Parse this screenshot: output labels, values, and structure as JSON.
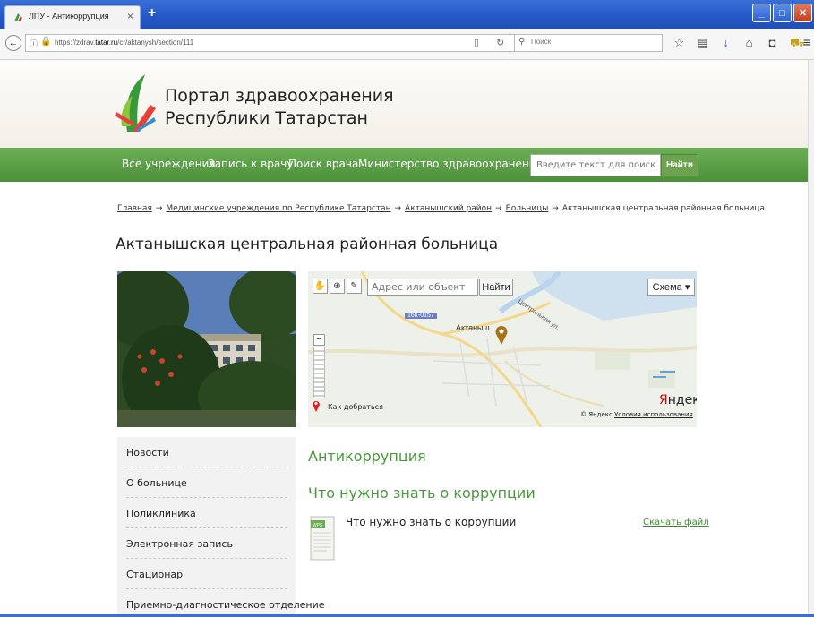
{
  "browser": {
    "tab_title": "ЛПУ - Антикоррупция",
    "tab_close": "×",
    "new_tab": "+",
    "url_prefix": "https://zdrav.",
    "url_domain": "tatar.ru",
    "url_path": "/cr/aktanysh/section/111",
    "search_placeholder": "Поиск",
    "icons": [
      "star-icon",
      "clipboard-icon",
      "download-icon",
      "home-icon",
      "pocket-icon",
      "cart-icon",
      "menu-icon"
    ]
  },
  "site": {
    "title_line1": "Портал здравоохранения",
    "title_line2": "Республики Татарстан",
    "nav": [
      "Все учреждения",
      "Запись к врачу",
      "Поиск врача",
      "Министерство здравоохранения РТ"
    ],
    "search_placeholder": "Введите текст для поиска",
    "search_button": "Найти"
  },
  "breadcrumb": {
    "items": [
      "Главная",
      "Медицинские учреждения по Республике Татарстан",
      "Актанышский район",
      "Больницы"
    ],
    "current": "Актанышская центральная районная больница",
    "separator": "→"
  },
  "page": {
    "title": "Актанышская центральная районная больница"
  },
  "map": {
    "search_placeholder": "Адрес или объект",
    "find_button": "Найти",
    "scheme_button": "Схема ▾",
    "city_label": "Актаныш",
    "road_label": "16К-0157",
    "street_label": "Центральная ул.",
    "route_link": "Как добраться",
    "brand_first": "Я",
    "brand_rest": "ндекс",
    "copyright": "© Яндекс",
    "terms_link": "Условия использования"
  },
  "sidebar": {
    "items": [
      "Новости",
      "О больнице",
      "Поликлиника",
      "Электронная запись",
      "Стационар",
      "Приемно-диагностическое отделение"
    ]
  },
  "content": {
    "section_title": "Антикоррупция",
    "subsection_title": "Что нужно знать о коррупции",
    "doc_title": "Что нужно знать о коррупции",
    "doc_badge": "WPS",
    "download_link": "Скачать файл"
  },
  "colors": {
    "green_nav": "#5a9f45",
    "section_title": "#4a9a3c",
    "title_bar": "#2457c5"
  }
}
